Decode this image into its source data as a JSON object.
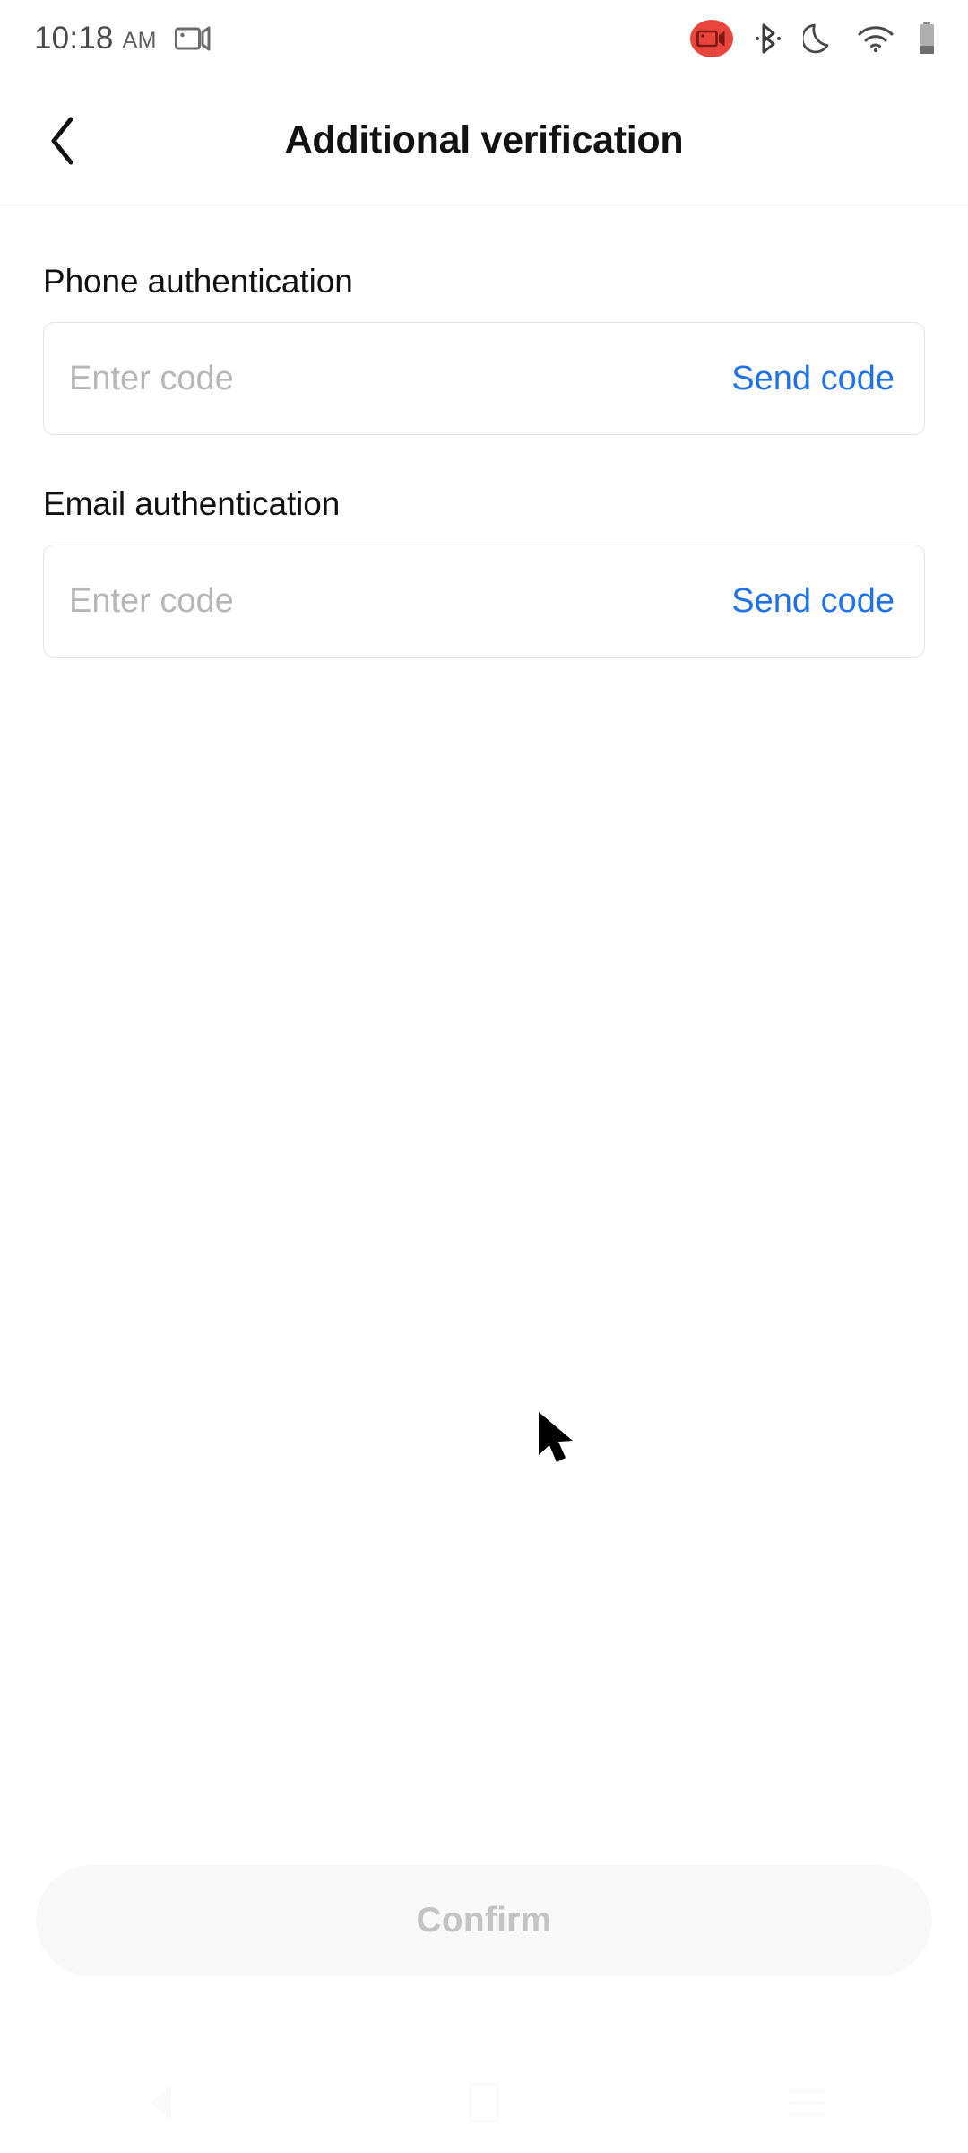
{
  "status_bar": {
    "time": "10:18",
    "ampm": "AM",
    "icons": [
      {
        "name": "video-recording-outline-icon",
        "position": "left"
      },
      {
        "name": "screen-record-active-icon",
        "position": "right",
        "color": "#e8453c"
      },
      {
        "name": "bluetooth-icon",
        "position": "right"
      },
      {
        "name": "do-not-disturb-moon-icon",
        "position": "right"
      },
      {
        "name": "wifi-icon",
        "position": "right"
      },
      {
        "name": "battery-icon",
        "position": "right"
      }
    ]
  },
  "header": {
    "back_icon": "chevron-left-icon",
    "title": "Additional verification"
  },
  "form": {
    "fields": [
      {
        "label": "Phone authentication",
        "placeholder": "Enter code",
        "value": "",
        "action_label": "Send code"
      },
      {
        "label": "Email authentication",
        "placeholder": "Enter code",
        "value": "",
        "action_label": "Send code"
      }
    ]
  },
  "footer": {
    "confirm_label": "Confirm",
    "confirm_enabled": false
  },
  "nav_bar": {
    "back_label": "Back",
    "home_label": "Home",
    "recents_label": "Recents"
  },
  "colors": {
    "accent_blue": "#1f72e8",
    "record_red": "#e8453c",
    "disabled_text": "#c3c3c3",
    "disabled_bg": "#f8f8f8",
    "border": "#e4e4e4",
    "placeholder": "#b6b6b6"
  }
}
